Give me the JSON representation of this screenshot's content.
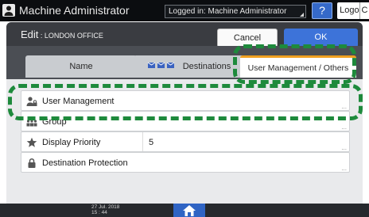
{
  "topbar": {
    "app_title": "Machine Administrator",
    "logged_in": "Logged in: Machine Administrator",
    "help_label": "?",
    "logout_label": "Logout",
    "corner_label": "C"
  },
  "dialog": {
    "title_prefix": "Edit",
    "title_separator": " : ",
    "title_name": "LONDON OFFICE",
    "cancel_label": "Cancel",
    "ok_label": "OK"
  },
  "tabs": [
    {
      "label": "Name",
      "selected": false
    },
    {
      "label": "Destinations",
      "selected": false
    },
    {
      "label": "User Management / Others",
      "selected": true
    }
  ],
  "rows": [
    {
      "label": "User Management",
      "value": "",
      "icon": "user-lock-icon"
    },
    {
      "label": "Group",
      "value": "",
      "icon": "group-icon"
    },
    {
      "label": "Display Priority",
      "value": "5",
      "icon": "star-icon"
    },
    {
      "label": "Destination Protection",
      "value": "",
      "icon": "lock-icon"
    }
  ],
  "row_more": "...",
  "status": {
    "date": "27 Jul. 2018",
    "time": "15 : 44"
  },
  "colors": {
    "highlight": "#1e8a3c",
    "accent_blue": "#3d73d9",
    "tab_selected_border": "#f0a020"
  }
}
